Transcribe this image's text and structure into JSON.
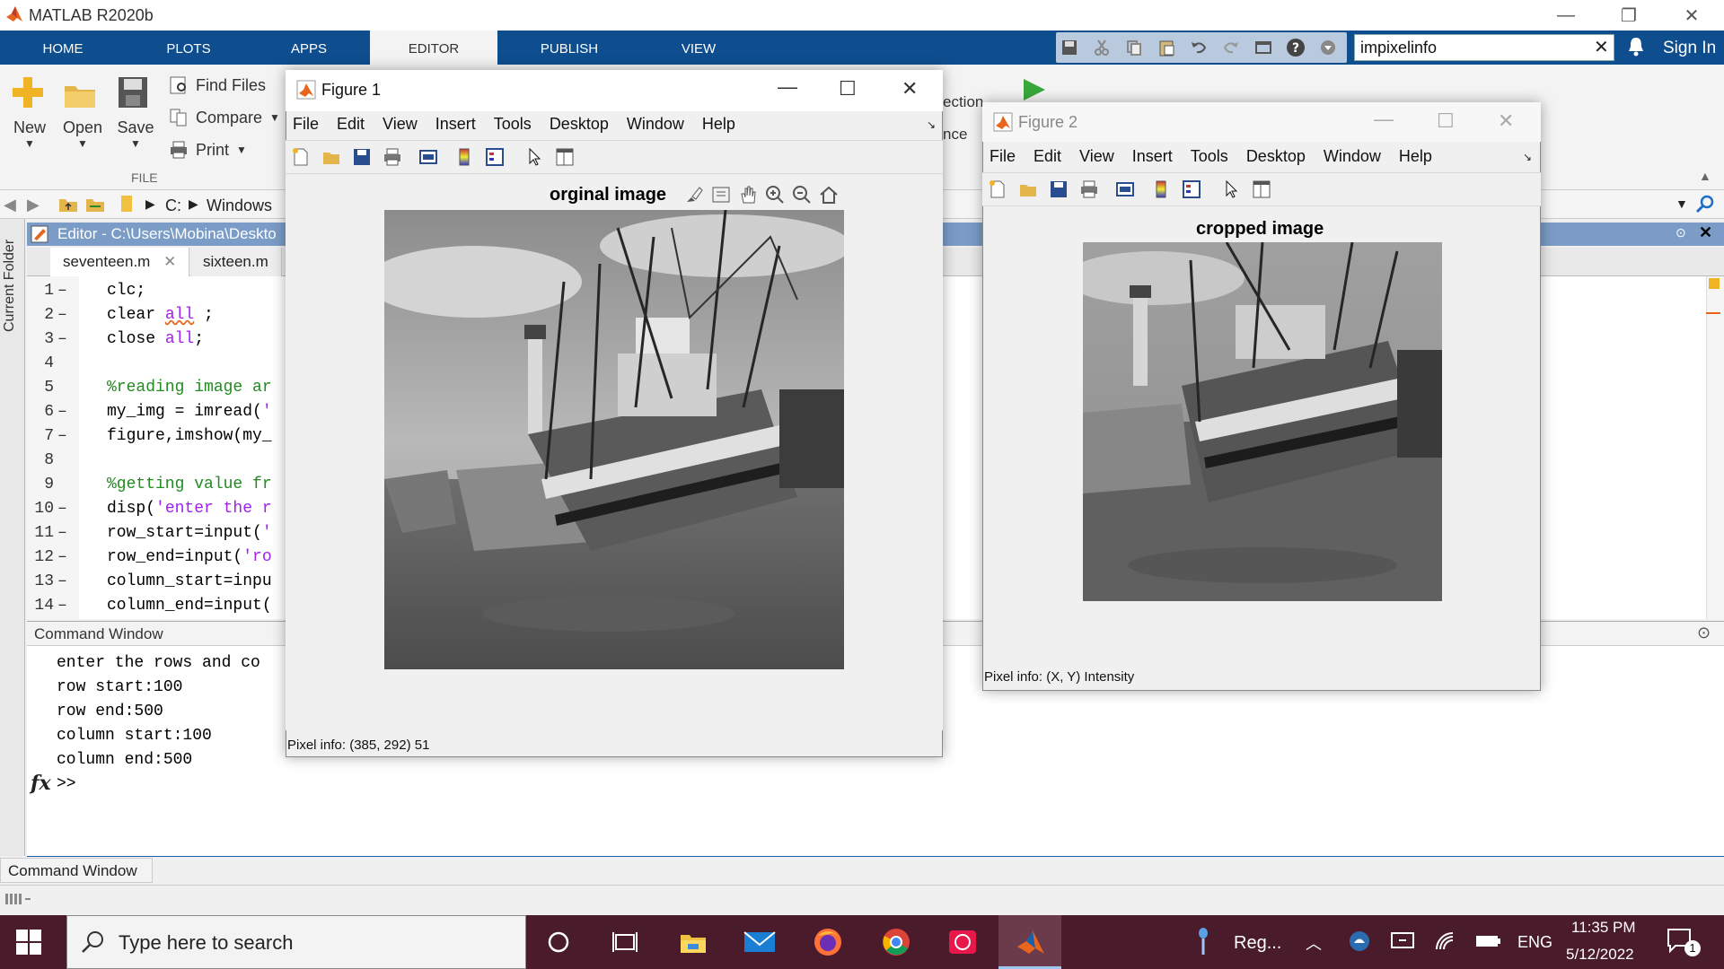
{
  "app": {
    "title": "MATLAB R2020b"
  },
  "tabs": [
    "HOME",
    "PLOTS",
    "APPS",
    "EDITOR",
    "PUBLISH",
    "VIEW"
  ],
  "active_tab": "EDITOR",
  "search": {
    "value": "impixelinfo"
  },
  "sign_in": "Sign In",
  "ribbon": {
    "new": "New",
    "open": "Open",
    "save": "Save",
    "find_files": "Find Files",
    "compare": "Compare",
    "print": "Print",
    "group_label": "FILE",
    "partial1": "ection",
    "partial2": "nce"
  },
  "address": {
    "drive": "C:",
    "folder": "Windows"
  },
  "sidebar": {
    "current_folder": "Current Folder"
  },
  "editor": {
    "title": "Editor - C:\\Users\\Mobina\\Deskto",
    "tabs": [
      "seventeen.m",
      "sixteen.m"
    ],
    "lines": [
      {
        "n": "1",
        "dash": true
      },
      {
        "n": "2",
        "dash": true
      },
      {
        "n": "3",
        "dash": true
      },
      {
        "n": "4",
        "dash": false
      },
      {
        "n": "5",
        "dash": false
      },
      {
        "n": "6",
        "dash": true
      },
      {
        "n": "7",
        "dash": true
      },
      {
        "n": "8",
        "dash": false
      },
      {
        "n": "9",
        "dash": false
      },
      {
        "n": "10",
        "dash": true
      },
      {
        "n": "11",
        "dash": true
      },
      {
        "n": "12",
        "dash": true
      },
      {
        "n": "13",
        "dash": true
      },
      {
        "n": "14",
        "dash": true
      }
    ],
    "code": {
      "l1": "clc;",
      "l2a": "clear ",
      "l2b": "all",
      "l2c": " ;",
      "l3a": "close ",
      "l3b": "all",
      "l3c": ";",
      "l5": "%reading image ar",
      "l6a": "my_img = imread(",
      "l6b": "'",
      "l7": "figure,imshow(my_",
      "l9": "%getting value fr",
      "l10a": "disp(",
      "l10b": "'enter the r",
      "l11a": "row_start=input(",
      "l11b": "'",
      "l12a": "row_end=input(",
      "l12b": "'ro",
      "l13": "column_start=inpu",
      "l14": "column_end=input("
    }
  },
  "command_window": {
    "title": "Command Window",
    "lines": [
      "enter the rows and co",
      "row start:100",
      "row end:500",
      "column start:100",
      "column end:500"
    ],
    "prompt": ">>",
    "fx": "fx",
    "tab_label": "Command Window"
  },
  "figure1": {
    "title": "Figure 1",
    "menu": [
      "File",
      "Edit",
      "View",
      "Insert",
      "Tools",
      "Desktop",
      "Window",
      "Help"
    ],
    "image_title": "orginal image",
    "pixel_info": "Pixel info: (385, 292)  51"
  },
  "figure2": {
    "title": "Figure 2",
    "menu": [
      "File",
      "Edit",
      "View",
      "Insert",
      "Tools",
      "Desktop",
      "Window",
      "Help"
    ],
    "image_title": "cropped image",
    "pixel_info": "Pixel info: (X, Y)  Intensity"
  },
  "taskbar": {
    "search_placeholder": "Type here to search",
    "tray_app": "Reg...",
    "language": "ENG",
    "time": "11:35 PM",
    "date": "5/12/2022",
    "notification_count": "1"
  },
  "colors": {
    "tab_bar": "#0e4d8e",
    "taskbar": "#4a1b2a",
    "editor_header": "#7a9cc6"
  }
}
